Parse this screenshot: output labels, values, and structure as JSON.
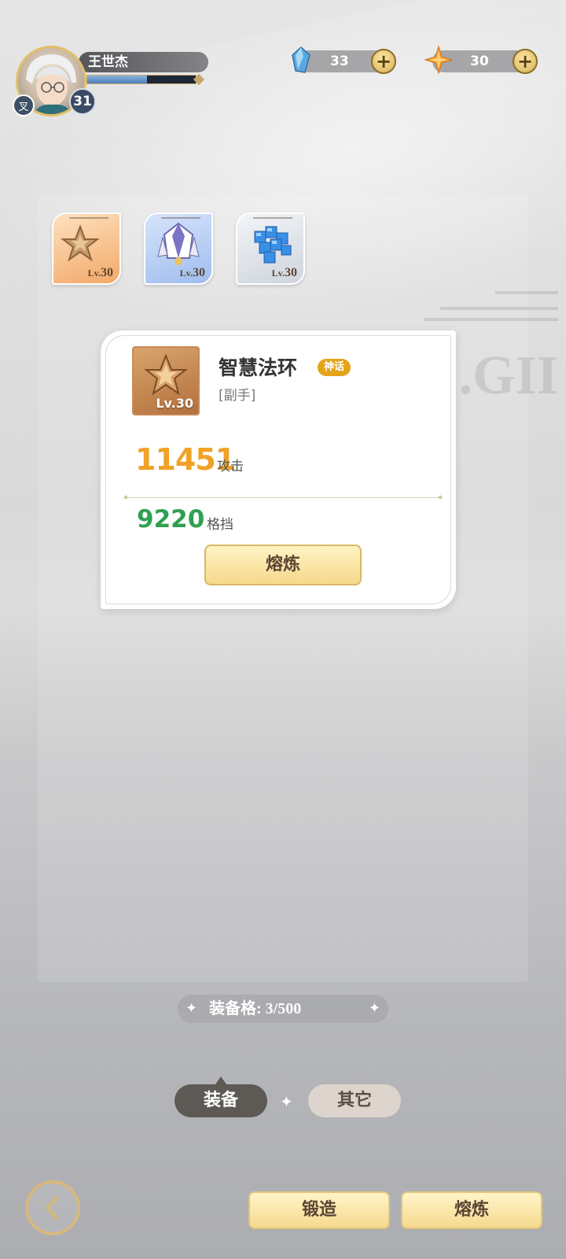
{
  "player": {
    "name": "王世杰",
    "level": "31",
    "class_badge": "叉",
    "xp_fraction": 0.55
  },
  "resources": [
    {
      "icon": "blue-gem-icon",
      "value": "33"
    },
    {
      "icon": "gold-star-icon",
      "value": "30"
    }
  ],
  "equipment_slots": [
    {
      "icon": "star-halo-icon",
      "level_prefix": "Lv.",
      "level": "30",
      "bg": "#f7c08a"
    },
    {
      "icon": "white-robe-icon",
      "level_prefix": "Lv.",
      "level": "30",
      "bg": "#bcd3f5"
    },
    {
      "icon": "blue-cube-icon",
      "level_prefix": "Lv.",
      "level": "30",
      "bg": "#e4e8ee"
    }
  ],
  "detail": {
    "name": "智慧法环",
    "rarity": "神话",
    "slot": "[副手]",
    "level": "Lv.30",
    "primary_value": "11451",
    "primary_label": "攻击",
    "secondary_value": "9220",
    "secondary_label": "格挡",
    "smelt_button": "熔炼"
  },
  "capacity": {
    "text": "装备格:  3/500"
  },
  "tabs": {
    "equip": "装备",
    "other": "其它"
  },
  "bottom": {
    "forge": "锻造",
    "smelt": "熔炼"
  }
}
